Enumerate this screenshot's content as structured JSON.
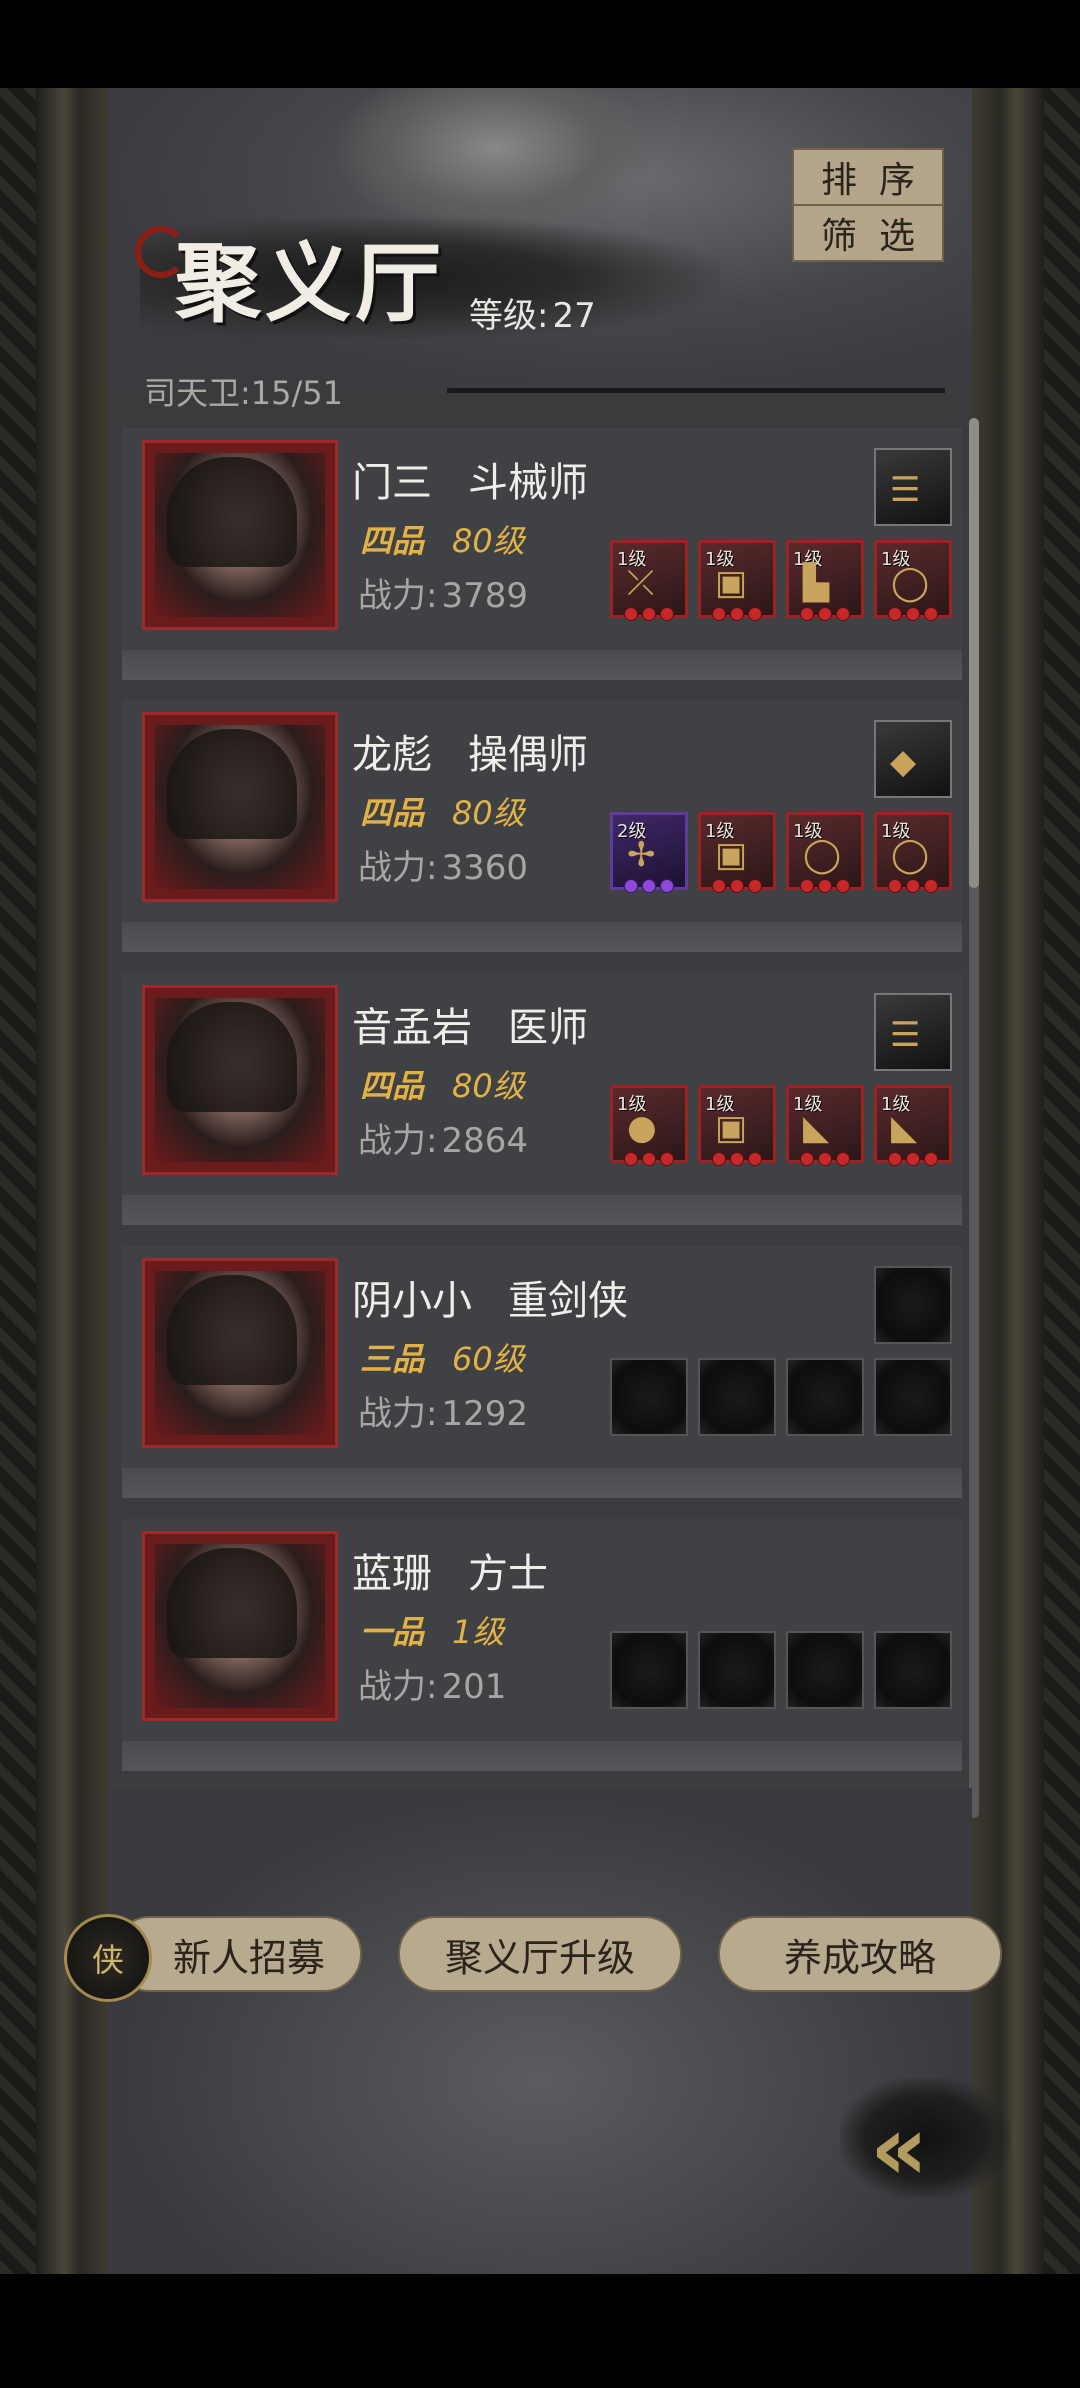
{
  "header": {
    "title": "聚义厅",
    "level_label": "等级:",
    "level_value": "27",
    "sort_label": "排序",
    "filter_label": "筛选",
    "roster_label": "司天卫:",
    "roster_value": "15/51"
  },
  "heroes": [
    {
      "name": "门三",
      "class": "斗械师",
      "grade": "四品",
      "level": "80级",
      "power_label": "战力:",
      "power": "3789",
      "slots": [
        {
          "lv": "1级",
          "icon": "crossbow-icon"
        },
        {
          "lv": "1级",
          "icon": "armor-icon"
        },
        {
          "lv": "1级",
          "icon": "boots-icon"
        },
        {
          "lv": "1级",
          "icon": "ring-icon"
        }
      ],
      "accessory": "scroll-icon"
    },
    {
      "name": "龙彪",
      "class": "操偶师",
      "grade": "四品",
      "level": "80级",
      "power_label": "战力:",
      "power": "3360",
      "slots": [
        {
          "lv": "2级",
          "icon": "puppet-icon"
        },
        {
          "lv": "1级",
          "icon": "armor-icon"
        },
        {
          "lv": "1级",
          "icon": "ring-icon"
        },
        {
          "lv": "1级",
          "icon": "ring-icon"
        }
      ],
      "accessory": "red-gem-icon"
    },
    {
      "name": "音孟岩",
      "class": "医师",
      "grade": "四品",
      "level": "80级",
      "power_label": "战力:",
      "power": "2864",
      "slots": [
        {
          "lv": "1级",
          "icon": "gourd-icon"
        },
        {
          "lv": "1级",
          "icon": "armor-icon"
        },
        {
          "lv": "1级",
          "icon": "cloth-icon"
        },
        {
          "lv": "1级",
          "icon": "cloth-icon"
        }
      ],
      "accessory": "scroll-icon"
    },
    {
      "name": "阴小小",
      "class": "重剑侠",
      "grade": "三品",
      "level": "60级",
      "power_label": "战力:",
      "power": "1292",
      "slots": [],
      "accessory": ""
    },
    {
      "name": "蓝珊",
      "class": "方士",
      "grade": "一品",
      "level": "1级",
      "power_label": "战力:",
      "power": "201",
      "slots": [],
      "accessory": null
    }
  ],
  "footer": {
    "recruit_label": "新人招募",
    "upgrade_label": "聚义厅升级",
    "guide_label": "养成攻略",
    "recruit_icon_glyph": "侠",
    "back_icon": "double-chevron-left-icon"
  }
}
